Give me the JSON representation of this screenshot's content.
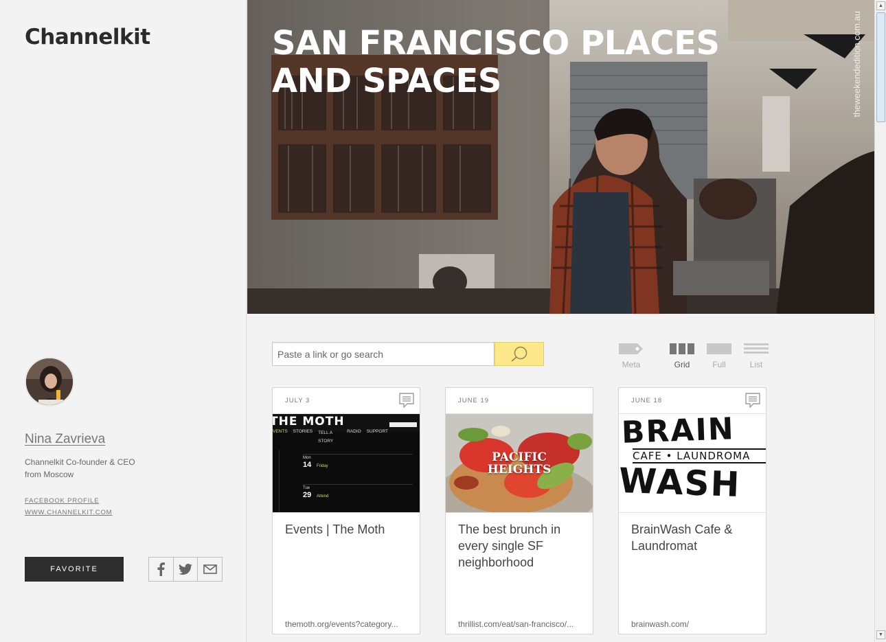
{
  "sidebar": {
    "logo": "Channelkit",
    "author": {
      "name": "Nina Zavrieva",
      "bio_line1": "Channelkit Co-founder & CEO",
      "bio_line2": "from Moscow",
      "links": [
        "FACEBOOK PROFILE",
        "WWW.CHANNELKIT.COM"
      ]
    },
    "favorite_label": "FAVORITE",
    "share_icons": [
      "facebook-icon",
      "twitter-icon",
      "mail-icon"
    ]
  },
  "hero": {
    "title": "SAN FRANCISCO PLACES AND SPACES",
    "credit": "theweekendedition.com.au"
  },
  "search": {
    "placeholder": "Paste a link or go search"
  },
  "views": [
    {
      "label": "Meta",
      "active": false
    },
    {
      "label": "Grid",
      "active": true
    },
    {
      "label": "Full",
      "active": false
    },
    {
      "label": "List",
      "active": false
    }
  ],
  "cards": [
    {
      "date": "JULY 3",
      "title": "Events | The Moth",
      "url": "themoth.org/events?category...",
      "image": {
        "brand": "THE MOTH",
        "nav": [
          "VENTS",
          "STORIES",
          "TELL A STORY",
          "RADIO",
          "SUPPORT"
        ],
        "rows": [
          {
            "day": "Mon",
            "date": "14",
            "label": "Friday"
          },
          {
            "day": "Tue",
            "date": "29",
            "label": "Attend"
          }
        ]
      }
    },
    {
      "date": "JUNE 19",
      "title": "The best brunch in every single SF neighborhood",
      "url": "thrillist.com/eat/san-francisco/...",
      "image": {
        "overlay": "PACIFIC HEIGHTS"
      }
    },
    {
      "date": "JUNE 18",
      "title": "BrainWash Cafe & Laundromat",
      "url": "brainwash.com/",
      "image": {
        "line1": "BRAIN",
        "line2": "CAFE • LAUNDROMA",
        "line3": "WASH"
      }
    }
  ],
  "colors": {
    "accent_yellow": "#fde98a",
    "dark_button": "#2e2e2e",
    "sidebar_bg": "#f3f3f3"
  }
}
